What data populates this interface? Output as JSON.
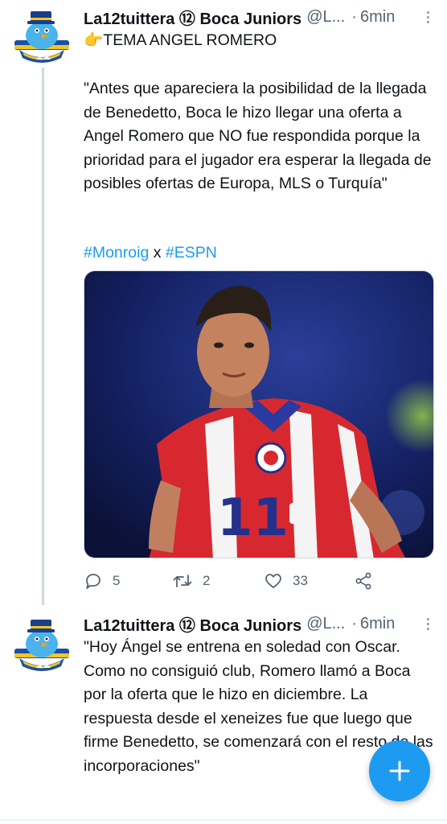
{
  "colors": {
    "accent": "#1d9bf0",
    "text": "#0f1419",
    "muted": "#536471"
  },
  "tweets": [
    {
      "author_name": "La12tuittera ⑫ Boca Juniors",
      "handle": "@L...",
      "separator": "·",
      "time": "6min",
      "title_emoji": "👉",
      "title": "TEMA ANGEL ROMERO",
      "quote": "\"Antes que apareciera la posibilidad de la llegada de Benedetto, Boca le hizo llegar una oferta a Angel Romero que NO fue respondida porque la prioridad para el jugador era esperar la llegada de posibles ofertas de Europa, MLS o Turquía\"",
      "tag1": "#Monroig",
      "tag_joiner": " x ",
      "tag2": "#ESPN",
      "media_icon": "player-photo",
      "actions": {
        "reply_count": "5",
        "retweet_count": "2",
        "like_count": "33"
      }
    },
    {
      "author_name": "La12tuittera ⑫ Boca Juniors",
      "handle": "@L...",
      "separator": "·",
      "time": "6min",
      "text": "\"Hoy Ángel se entrena en soledad con Oscar. Como no consiguió club, Romero llamó a Boca por la oferta que le hizo en diciembre. La respuesta desde el xeneizes fue que luego que firme Benedetto, se comenzará con el resto de las incorporaciones\""
    }
  ],
  "fab": {
    "icon": "plus-icon"
  }
}
